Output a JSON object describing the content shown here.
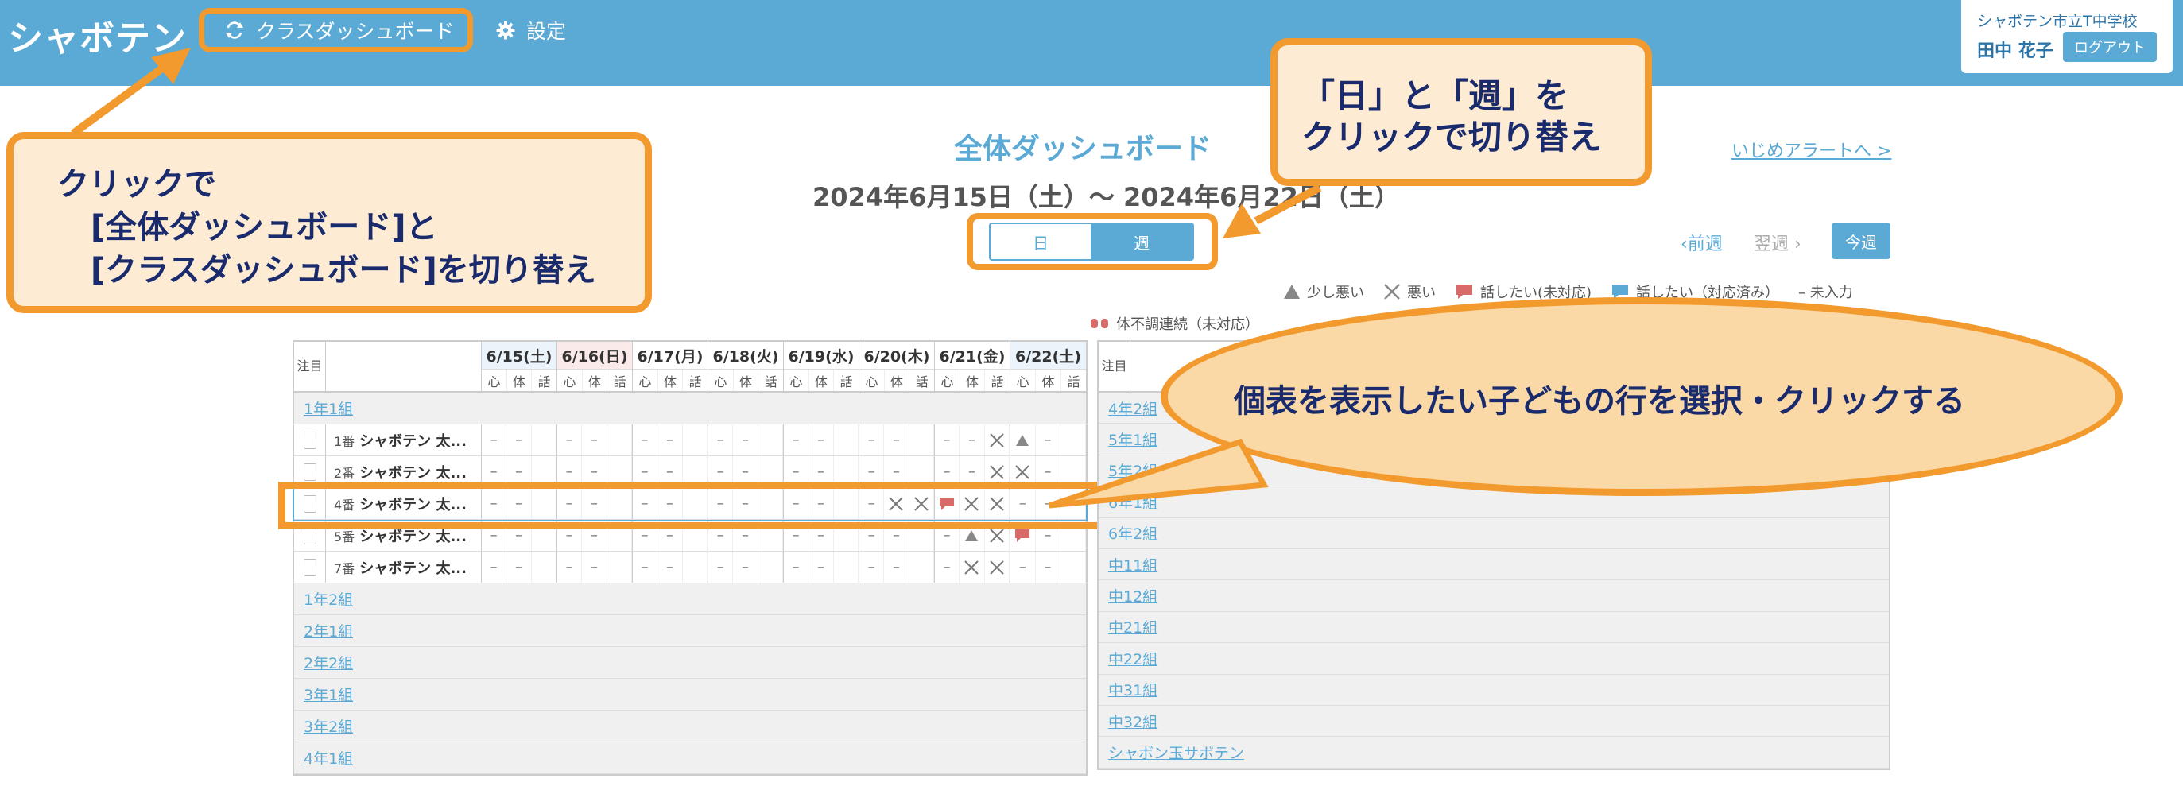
{
  "header": {
    "logo": "シャボテン",
    "nav_class": "クラスダッシュボード",
    "nav_settings": "設定",
    "school": "シャボテン市立T中学校",
    "user": "田中 花子",
    "logout": "ログアウト"
  },
  "main": {
    "title": "全体ダッシュボード",
    "date_range": "2024年6月15日（土）〜 2024年6月22日（土）",
    "bully_link": "いじめアラートへ >",
    "toggle_day": "日",
    "toggle_week": "週",
    "prev_week": "前週",
    "next_week": "翌週",
    "this_week": "今週"
  },
  "legend": {
    "slightly_bad": "少し悪い",
    "bad": "悪い",
    "talk_unhandled": "話したい(未対応)",
    "talk_handled": "話したい（対応済み）",
    "not_entered": "– 未入力",
    "sick_unhandled": "体不調連続（未対応）"
  },
  "left_table": {
    "star_header": "注目",
    "days": [
      "6/15(土)",
      "6/16(日)",
      "6/17(月)",
      "6/18(火)",
      "6/19(水)",
      "6/20(木)",
      "6/21(金)",
      "6/22(土)"
    ],
    "sub_headers": [
      "心",
      "体",
      "話"
    ],
    "group_1": "1年1組",
    "students": [
      {
        "num": "1番",
        "name": "シャボテン 太..."
      },
      {
        "num": "2番",
        "name": "シャボテン 太..."
      },
      {
        "num": "4番",
        "name": "シャボテン 太..."
      },
      {
        "num": "5番",
        "name": "シャボテン 太..."
      },
      {
        "num": "7番",
        "name": "シャボテン 太..."
      }
    ],
    "groups_after": [
      "1年2組",
      "2年1組",
      "2年2組",
      "3年1組",
      "3年2組",
      "4年1組"
    ]
  },
  "right_table": {
    "star_header": "注目",
    "groups": [
      "4年2組",
      "5年1組",
      "5年2組",
      "6年1組",
      "6年2組",
      "中11組",
      "中12組",
      "中21組",
      "中22組",
      "中31組",
      "中32組",
      "シャボン玉サボテン"
    ]
  },
  "annotations": {
    "callout1_line1": "クリックで",
    "callout1_line2": "[全体ダッシュボード]と",
    "callout1_line3": "[クラスダッシュボード]を切り替え",
    "callout2_line1": "「日」と「週」を",
    "callout2_line2": "クリックで切り替え",
    "ellipse_text": "個表を表示したい子どもの行を選択・クリックする"
  },
  "colors": {
    "header": "#5aaad5",
    "accent_orange": "#f29a2e",
    "callout_fill": "#fdebd3",
    "ellipse_fill": "#fad9a6",
    "callout_text": "#1a2b6d",
    "talk_unhandled": "#d96a6a"
  }
}
